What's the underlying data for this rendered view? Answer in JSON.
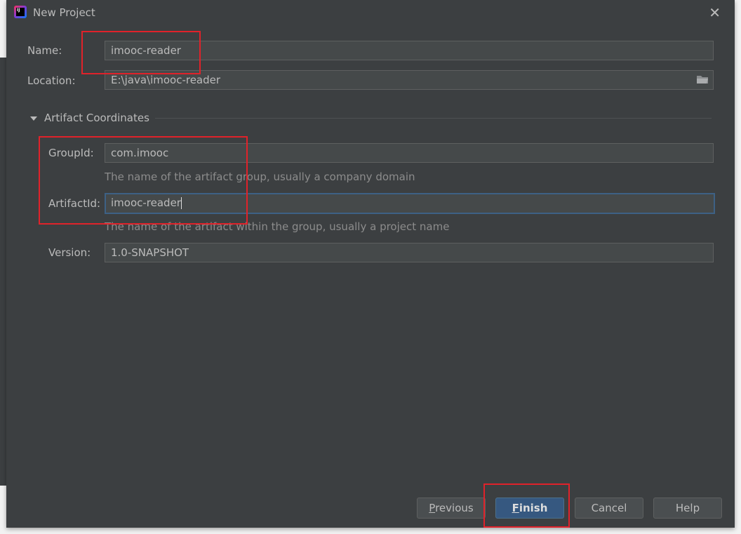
{
  "window": {
    "title": "New Project"
  },
  "form": {
    "name_label": "Name:",
    "name_value": "imooc-reader",
    "location_label": "Location:",
    "location_value": "E:\\java\\imooc-reader",
    "section_title": "Artifact Coordinates",
    "groupid_label": "GroupId:",
    "groupid_value": "com.imooc",
    "groupid_hint": "The name of the artifact group, usually a company domain",
    "artifactid_label": "ArtifactId:",
    "artifactid_value": "imooc-reader",
    "artifactid_hint": "The name of the artifact within the group, usually a project name",
    "version_label": "Version:",
    "version_value": "1.0-SNAPSHOT"
  },
  "buttons": {
    "previous_mn": "P",
    "previous_rest": "revious",
    "finish_mn": "F",
    "finish_rest": "inish",
    "cancel": "Cancel",
    "help": "Help"
  },
  "colors": {
    "accent": "#365880",
    "annotation": "#e0222a",
    "background": "#3c3f41"
  }
}
